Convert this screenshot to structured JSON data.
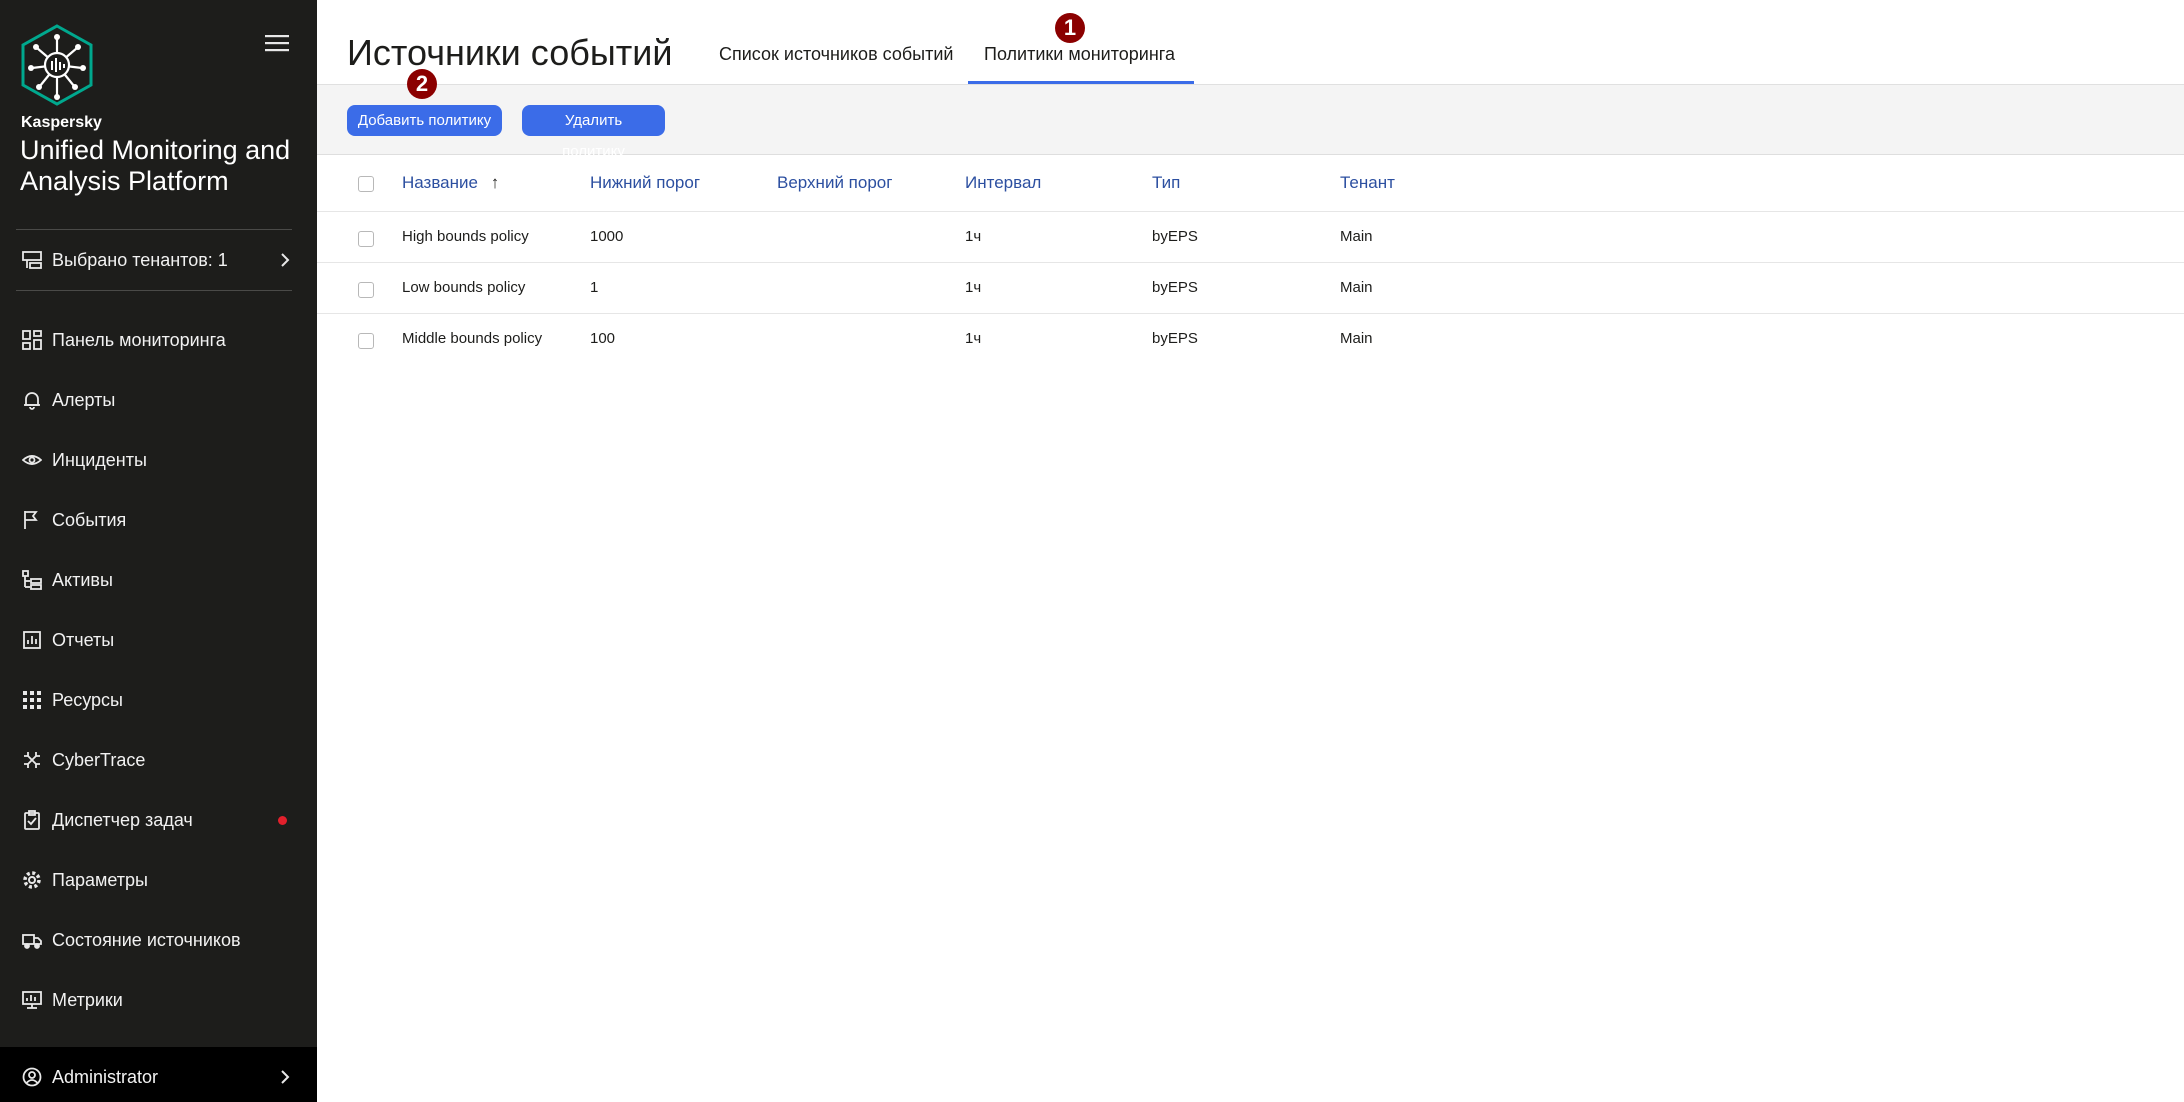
{
  "sidebar": {
    "brand_small": "Kaspersky",
    "brand_title": "Unified Monitoring and Analysis Platform",
    "tenants_label": "Выбрано тенантов: 1",
    "items": [
      {
        "label": "Панель мониторинга",
        "icon": "dashboard-icon"
      },
      {
        "label": "Алерты",
        "icon": "bell-icon"
      },
      {
        "label": "Инциденты",
        "icon": "eye-icon"
      },
      {
        "label": "События",
        "icon": "flag-icon"
      },
      {
        "label": "Активы",
        "icon": "assets-icon"
      },
      {
        "label": "Отчеты",
        "icon": "report-icon"
      },
      {
        "label": "Ресурсы",
        "icon": "grid-icon"
      },
      {
        "label": "CyberTrace",
        "icon": "cybertrace-icon"
      },
      {
        "label": "Диспетчер задач",
        "icon": "clipboard-check-icon"
      },
      {
        "label": "Параметры",
        "icon": "gear-icon"
      },
      {
        "label": "Состояние источников",
        "icon": "truck-icon"
      },
      {
        "label": "Метрики",
        "icon": "monitor-icon"
      }
    ],
    "user_label": "Administrator",
    "colors": {
      "background": "#1d1d1b",
      "notification_dot": "#e2202c"
    }
  },
  "header": {
    "title": "Источники событий",
    "tabs": [
      {
        "label": "Список источников событий",
        "active": false
      },
      {
        "label": "Политики мониторинга",
        "active": true
      }
    ]
  },
  "toolbar": {
    "add_label": "Добавить политику",
    "delete_label": "Удалить политику"
  },
  "annotations": [
    "1",
    "2"
  ],
  "table": {
    "columns": [
      "Название",
      "Нижний порог",
      "Верхний порог",
      "Интервал",
      "Тип",
      "Тенант"
    ],
    "sort_arrow": "↑",
    "rows": [
      {
        "name": "High bounds policy",
        "low": "1000",
        "high": "",
        "interval": "1ч",
        "type": "byEPS",
        "tenant": "Main"
      },
      {
        "name": "Low bounds policy",
        "low": "1",
        "high": "",
        "interval": "1ч",
        "type": "byEPS",
        "tenant": "Main"
      },
      {
        "name": "Middle bounds policy",
        "low": "100",
        "high": "",
        "interval": "1ч",
        "type": "byEPS",
        "tenant": "Main"
      }
    ]
  },
  "colors": {
    "accent": "#3b6ce8",
    "header_text": "#2c4fa0",
    "badge": "#8b0000"
  }
}
